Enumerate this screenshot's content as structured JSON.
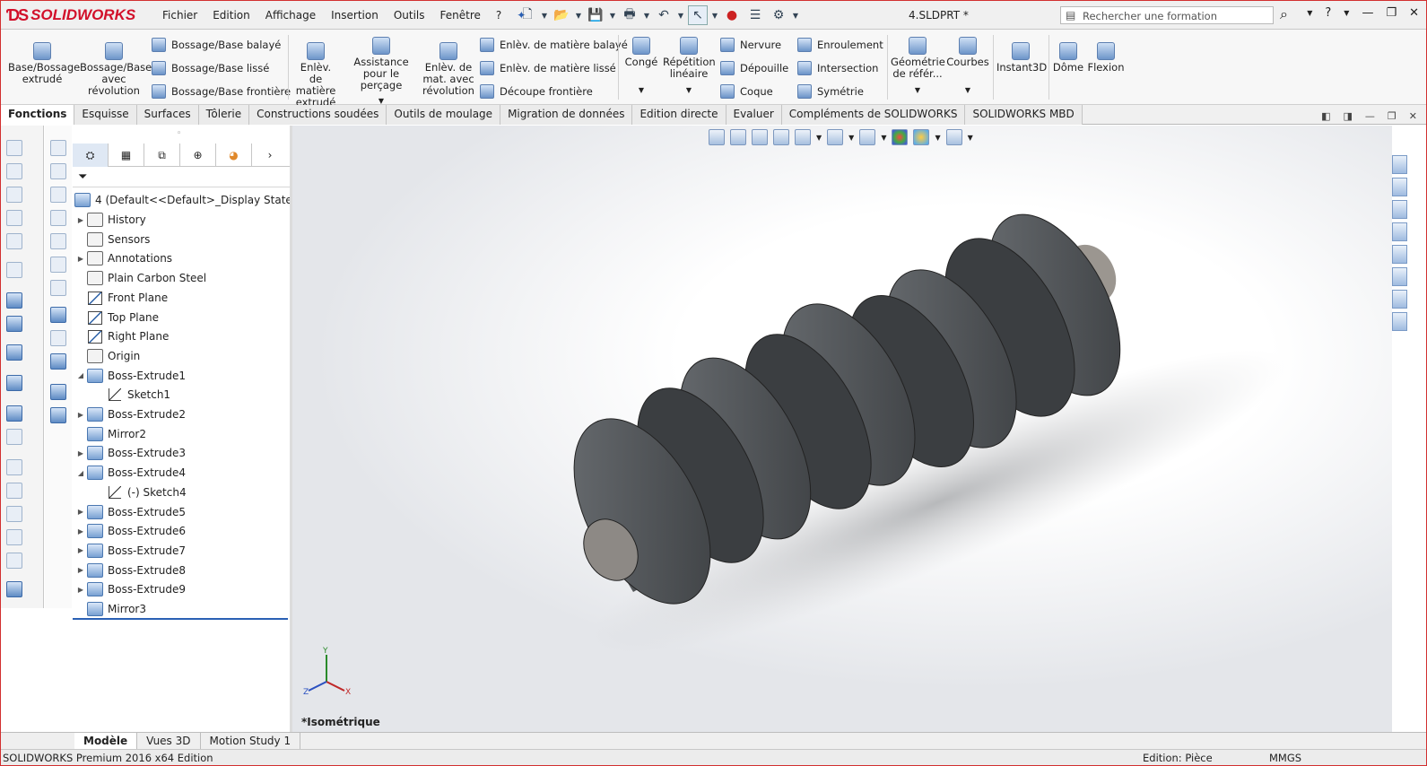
{
  "app": {
    "brand": "SOLIDWORKS",
    "document_title": "4.SLDPRT *"
  },
  "menu": [
    "Fichier",
    "Edition",
    "Affichage",
    "Insertion",
    "Outils",
    "Fenêtre",
    "?"
  ],
  "search": {
    "placeholder": "Rechercher une formation"
  },
  "commands": {
    "boss_extrude": "Base/Bossage extrudé",
    "boss_revolve": "Bossage/Base avec révolution",
    "swept_boss": "Bossage/Base balayé",
    "lofted_boss": "Bossage/Base lissé",
    "boundary_boss": "Bossage/Base frontière",
    "extruded_cut": "Enlèv. de matière extrudé",
    "hole_wizard": "Assistance pour le perçage",
    "revolved_cut": "Enlèv. de mat. avec révolution",
    "swept_cut": "Enlèv. de matière balayé",
    "lofted_cut": "Enlèv. de matière lissé",
    "boundary_cut": "Découpe frontière",
    "fillet": "Congé",
    "linear_pattern": "Répétition linéaire",
    "rib": "Nervure",
    "draft": "Dépouille",
    "shell": "Coque",
    "wrap": "Enroulement",
    "intersect": "Intersection",
    "mirror": "Symétrie",
    "ref_geometry": "Géométrie de référ...",
    "curves": "Courbes",
    "instant3d": "Instant3D",
    "dome": "Dôme",
    "flex": "Flexion"
  },
  "tabs": [
    "Fonctions",
    "Esquisse",
    "Surfaces",
    "Tôlerie",
    "Constructions soudées",
    "Outils de moulage",
    "Migration de données",
    "Edition directe",
    "Evaluer",
    "Compléments de SOLIDWORKS",
    "SOLIDWORKS MBD"
  ],
  "tree": {
    "root": "4  (Default<<Default>_Display State 1>)",
    "items": [
      {
        "label": "History",
        "icon": "history-folder-icon"
      },
      {
        "label": "Sensors",
        "icon": "sensors-icon"
      },
      {
        "label": "Annotations",
        "icon": "annotations-icon"
      },
      {
        "label": "Plain Carbon Steel",
        "icon": "material-icon"
      },
      {
        "label": "Front Plane",
        "icon": "plane-icon"
      },
      {
        "label": "Top Plane",
        "icon": "plane-icon"
      },
      {
        "label": "Right Plane",
        "icon": "plane-icon"
      },
      {
        "label": "Origin",
        "icon": "origin-icon"
      },
      {
        "label": "Boss-Extrude1",
        "icon": "extrude-icon"
      },
      {
        "label": "Sketch1",
        "icon": "sketch-icon"
      },
      {
        "label": "Boss-Extrude2",
        "icon": "extrude-icon"
      },
      {
        "label": "Mirror2",
        "icon": "mirror-icon"
      },
      {
        "label": "Boss-Extrude3",
        "icon": "extrude-icon"
      },
      {
        "label": "Boss-Extrude4",
        "icon": "extrude-icon"
      },
      {
        "label": "(-) Sketch4",
        "icon": "sketch-icon"
      },
      {
        "label": "Boss-Extrude5",
        "icon": "extrude-icon"
      },
      {
        "label": "Boss-Extrude6",
        "icon": "extrude-icon"
      },
      {
        "label": "Boss-Extrude7",
        "icon": "extrude-icon"
      },
      {
        "label": "Boss-Extrude8",
        "icon": "extrude-icon"
      },
      {
        "label": "Boss-Extrude9",
        "icon": "extrude-icon"
      },
      {
        "label": "Mirror3",
        "icon": "mirror-icon"
      }
    ]
  },
  "viewport": {
    "view_name": "*Isométrique",
    "axis_x": "X",
    "axis_y": "Y",
    "axis_z": "Z"
  },
  "bottom_tabs": [
    "Modèle",
    "Vues 3D",
    "Motion Study 1"
  ],
  "status": {
    "product": "SOLIDWORKS Premium 2016 x64 Edition",
    "mode": "Edition: Pièce",
    "units": "MMGS"
  },
  "colors": {
    "brand": "#d2102a",
    "part": "#4a4d50",
    "accent": "#2a60b4"
  }
}
